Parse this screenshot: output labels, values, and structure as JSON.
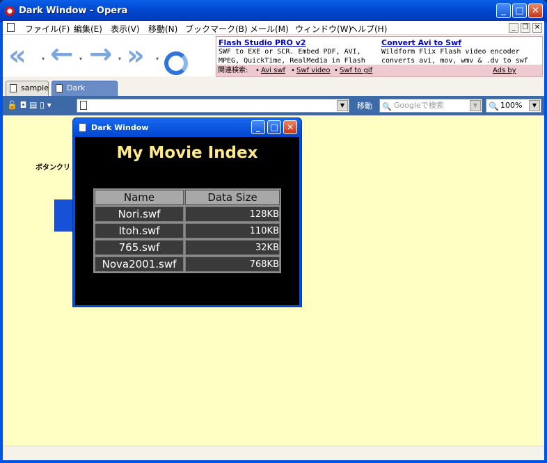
{
  "window": {
    "title": "Dark Window - Opera"
  },
  "menu": [
    "ファイル(F)",
    "編集(E)",
    "表示(V)",
    "移動(N)",
    "ブックマーク(B)",
    "メール(M)",
    "ウィンドウ(W)",
    "ヘルプ(H)"
  ],
  "ads": {
    "ad1": {
      "title": "Flash Studio PRO v2",
      "text": "SWF to EXE or SCR. Embed PDF, AVI, MPEG, QuickTime, RealMedia in Flash"
    },
    "ad2": {
      "title": "Convert Avi to Swf",
      "text": "Wildform Flix Flash video encoder converts avi, mov, wmv & .dv to swf"
    },
    "related_label": "関連検索:",
    "related": [
      "Avi swf",
      "Swf video",
      "Swf to gif"
    ],
    "byline": "Ads by Google"
  },
  "tabs": [
    {
      "label": "sample",
      "active": false
    },
    {
      "label": "Dark Window",
      "active": true
    }
  ],
  "address": {
    "value": "",
    "goto_label": "移動",
    "search_placeholder": "Googleで検索",
    "zoom": "100%"
  },
  "page": {
    "text": "ボタンクリ"
  },
  "popup": {
    "title": "Dark Window",
    "heading": "My Movie Index",
    "columns": [
      "Name",
      "Data Size"
    ],
    "rows": [
      {
        "name": "Nori.swf",
        "size": "128KB"
      },
      {
        "name": "Itoh.swf",
        "size": "110KB"
      },
      {
        "name": "765.swf",
        "size": "32KB"
      },
      {
        "name": "Nova2001.swf",
        "size": "768KB"
      }
    ]
  },
  "colors": {
    "page_bg": "#ffffc4",
    "heading": "#ffe98a",
    "xp_blue": "#0054e3"
  }
}
